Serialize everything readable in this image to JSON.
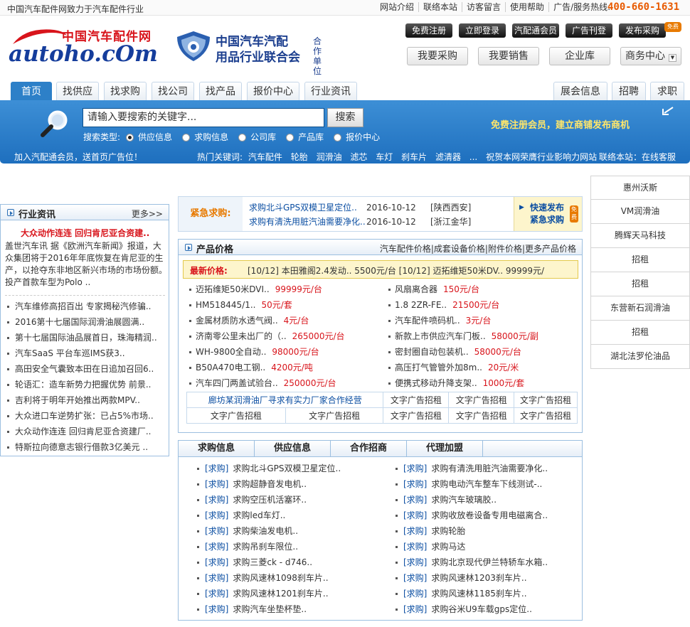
{
  "topbar": {
    "slogan": "中国汽车配件网致力于汽车配件行业",
    "links": [
      "网站介绍",
      "联络本站",
      "访客留言",
      "使用帮助",
      "广告/服务热线:"
    ],
    "hotline": "400-660-1631"
  },
  "logo": {
    "cn": "中国汽车配件网",
    "en": "autoho.cOm"
  },
  "association": {
    "line1": "中国汽车汽配",
    "line2": "用品行业联合会",
    "suffix": "合作单位"
  },
  "header_buttons": [
    "免费注册",
    "立即登录",
    "汽配通会员",
    "广告刊登",
    "发布采购"
  ],
  "new_badge": "免费",
  "action_buttons": [
    "我要采购",
    "我要销售",
    "企业库",
    "商务中心"
  ],
  "nav_tabs": [
    "首页",
    "找供应",
    "找求购",
    "找公司",
    "找产品",
    "报价中心",
    "行业资讯"
  ],
  "nav_tabs_right": [
    "展会信息",
    "招聘",
    "求职"
  ],
  "search": {
    "placeholder": "请输入要搜索的关键字...",
    "button": "搜索",
    "type_label": "搜索类型:",
    "types": [
      "供应信息",
      "求购信息",
      "公司库",
      "产品库",
      "报价中心"
    ],
    "selected": "供应信息",
    "register_note": "免费注册会员，建立商铺发布商机"
  },
  "hotrow": {
    "join": "加入汽配通会员，送首页广告位！",
    "keywords_label": "热门关键词:",
    "keywords": [
      "汽车配件",
      "轮胎",
      "润滑油",
      "滤芯",
      "车灯",
      "刹车片",
      "滤清器",
      "..."
    ],
    "congrats": "祝贺本网荣膺行业影响力网站",
    "service": "联络本站：在线客服"
  },
  "right_ads": [
    "惠州沃斯",
    "VM润滑油",
    "腾辉天马科技",
    "招租",
    "招租",
    "东营新石润滑油",
    "招租",
    "湖北法罗伦油品"
  ],
  "news": {
    "title": "行业资讯",
    "more": "更多>>",
    "headline": "大众动作连连 回归肯尼亚合资建..",
    "summary": "盖世汽车讯 据《欧洲汽车新闻》报道，大众集团将于2016年年底恢复在肯尼亚的生产，以抢夺东非地区新兴市场的市场份额。投产首款车型为Polo ..",
    "items": [
      "汽车维修高招百出 专家揭秘汽修骗..",
      "2016第十七届国际润滑油展圆满..",
      "第十七届国际油品展首日，珠海精润..",
      "汽车SaaS 平台车巡IMS获3..",
      "高田安全气囊致本田在日追加召回6..",
      "轮语汇：造车新势力把握优势 前景..",
      "吉利将于明年开始推出两款MPV..",
      "大众进口车逆势扩张：已占5%市场..",
      "大众动作连连 回归肯尼亚合资建厂..",
      "特斯拉向德意志银行借款3亿美元 .."
    ]
  },
  "urgent": {
    "label": "紧急求购:",
    "rows": [
      {
        "name": "求购北斗GPS双模卫星定位..",
        "date": "2016-10-12",
        "place": "[陕西西安]"
      },
      {
        "name": "求购有清洗用脏汽油需要净化..",
        "date": "2016-10-12",
        "place": "[浙江金华]"
      }
    ],
    "quick1": "快速发布",
    "quick2": "紧急求购",
    "free_badge": "免费"
  },
  "prices": {
    "title": "产品价格",
    "links": "汽车配件价格|成套设备价格|附件价格|更多产品价格",
    "latest_label": "最新价格:",
    "latest_text": "[10/12] 本田雅阁2.4发动.. 5500元/台     [10/12] 迈拓维矩50米DV.. 99999元/",
    "items": [
      {
        "name": "迈拓维矩50米DVI..",
        "price": "99999元/台"
      },
      {
        "name": "风扇离合器",
        "price": "150元/台"
      },
      {
        "name": "HM518445/1..",
        "price": "50元/套"
      },
      {
        "name": "1.8 2ZR-FE..",
        "price": "21500元/台"
      },
      {
        "name": "金属材质防水透气阀..",
        "price": "4元/台"
      },
      {
        "name": "汽车配件喷码机..",
        "price": "3元/台"
      },
      {
        "name": "济南零公里未出厂的（..",
        "price": "265000元/台"
      },
      {
        "name": "新款上市供应汽车门板..",
        "price": "58000元/副"
      },
      {
        "name": "WH-9800全自动..",
        "price": "98000元/台"
      },
      {
        "name": "密封圈自动包装机..",
        "price": "58000元/台"
      },
      {
        "name": "B50A470电工钢..",
        "price": "4200元/吨"
      },
      {
        "name": "高压打气管管外加8m..",
        "price": "20元/米"
      },
      {
        "name": "汽车四门两盖试验台..",
        "price": "250000元/台"
      },
      {
        "name": "便携式移动升降支架..",
        "price": "1000元/套"
      }
    ],
    "ad_grid": [
      [
        "廊坊某润滑油厂寻求有实力厂家合作经营",
        "文字广告招租",
        "文字广告招租",
        "文字广告招租"
      ],
      [
        "文字广告招租",
        "文字广告招租",
        "文字广告招租",
        "文字广告招租",
        "文字广告招租"
      ]
    ]
  },
  "info": {
    "tabs": [
      "求购信息",
      "供应信息",
      "合作招商",
      "代理加盟"
    ],
    "tag": "[求购]",
    "left": [
      "求购北斗GPS双模卫星定位..",
      "求购超静音发电机..",
      "求购空压机活塞环..",
      "求购led车灯..",
      "求购柴油发电机..",
      "求购吊刹车限位..",
      "求购三菱ck - d746..",
      "求购风速林1098刹车片..",
      "求购风速林1201刹车片..",
      "求购汽车坐垫杯垫.."
    ],
    "right": [
      "求购有清洗用脏汽油需要净化..",
      "求购电动汽车整车下线测试-..",
      "求购汽车玻璃胶..",
      "求购收放卷设备专用电磁离合..",
      "求购轮胎",
      "求购马达",
      "求购北京现代伊兰特轿车水箱..",
      "求购风速林1203刹车片..",
      "求购风速林1185刹车片..",
      "求购谷米U9车载gps定位.."
    ]
  }
}
